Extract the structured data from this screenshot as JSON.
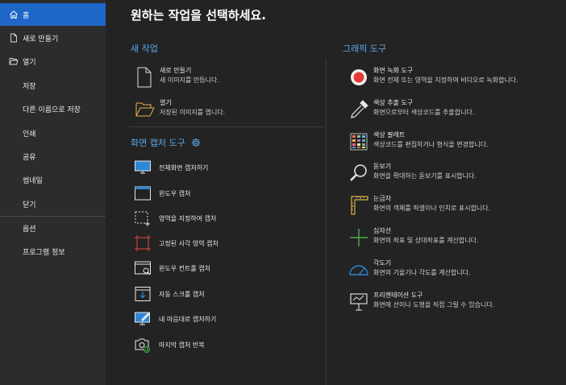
{
  "sidebar": {
    "items": [
      {
        "label": "홈",
        "icon": "home-icon",
        "active": true
      },
      {
        "label": "새로 만들기",
        "icon": "new-file-icon"
      },
      {
        "label": "열기",
        "icon": "open-folder-icon"
      },
      {
        "label": "저장"
      },
      {
        "label": "다른 이름으로 저장"
      },
      {
        "label": "인쇄"
      },
      {
        "label": "공유"
      },
      {
        "label": "썸네일"
      },
      {
        "label": "닫기"
      },
      {
        "label": "옵션"
      },
      {
        "label": "프로그램 정보"
      }
    ]
  },
  "main": {
    "title": "원하는 작업을 선택하세요.",
    "new_task": {
      "heading": "새 작업",
      "items": [
        {
          "title": "새로 만들기",
          "desc": "새 이미지를 만듭니다.",
          "icon": "new-document-icon"
        },
        {
          "title": "열기",
          "desc": "저장된 이미지를 엽니다.",
          "icon": "open-folder-icon"
        }
      ]
    },
    "capture": {
      "heading": "화면 캡처 도구",
      "settings_icon": "gear-icon",
      "items": [
        {
          "label": "전체화면 캡처하기",
          "icon": "monitor-icon"
        },
        {
          "label": "윈도우 캡처",
          "icon": "window-icon"
        },
        {
          "label": "영역을 지정하여 캡처",
          "icon": "region-select-icon"
        },
        {
          "label": "고정된 사각 영역 캡처",
          "icon": "fixed-region-icon"
        },
        {
          "label": "윈도우 컨트롤 캡처",
          "icon": "window-control-icon"
        },
        {
          "label": "자동 스크롤 캡처",
          "icon": "scroll-capture-icon"
        },
        {
          "label": "내 마음대로 캡처하기",
          "icon": "freehand-capture-icon"
        },
        {
          "label": "마지막 캡처 반복",
          "icon": "repeat-capture-icon"
        }
      ]
    },
    "graphic": {
      "heading": "그래픽 도구",
      "items": [
        {
          "title": "화면 녹화 도구",
          "desc": "화면 전체 또는 영역을 지정하여 비디오로 녹화합니다.",
          "icon": "record-icon"
        },
        {
          "title": "색상 추출 도구",
          "desc": "화면으로부터 색상코드를 추출합니다.",
          "icon": "eyedropper-icon"
        },
        {
          "title": "색상 팔레트",
          "desc": "색상코드를 편집하거나 형식을 변경합니다.",
          "icon": "palette-icon"
        },
        {
          "title": "돋보기",
          "desc": "화면을 확대하는 돋보기를 표시합니다.",
          "icon": "magnifier-icon"
        },
        {
          "title": "눈금자",
          "desc": "화면의 객체를 픽셀이나 인치로 표시합니다.",
          "icon": "ruler-icon"
        },
        {
          "title": "십자선",
          "desc": "화면의 좌표 및 상대좌표를 계산합니다.",
          "icon": "crosshair-icon"
        },
        {
          "title": "각도기",
          "desc": "화면의 기울기나 각도를 계산합니다.",
          "icon": "protractor-icon"
        },
        {
          "title": "프리젠테이션 도구",
          "desc": "화면에 선이나 도형을 직접 그릴 수 있습니다.",
          "icon": "presentation-icon"
        }
      ]
    }
  },
  "colors": {
    "accent": "#1f66c9",
    "section_heading": "#5aa7ea",
    "record": "#e53935"
  }
}
